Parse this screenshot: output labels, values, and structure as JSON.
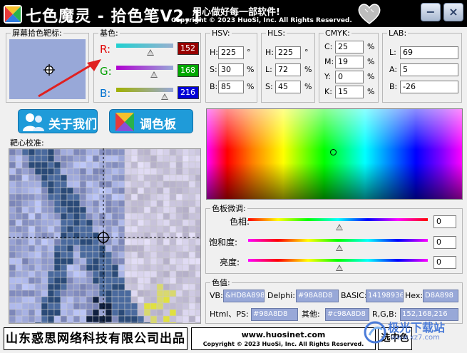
{
  "titlebar": {
    "title": "七色魔灵 - 拾色笔V2.1",
    "slogan": "用心做好每一部软件!",
    "copyright": "Copyright © 2023 HuoSi, Inc. All Rights Reserved.",
    "minimize": "−",
    "close": "×"
  },
  "target_preview": {
    "label": "屏幕拾色靶标:"
  },
  "base_color": {
    "label": "基色:",
    "channels": [
      {
        "name": "R:",
        "value": "152",
        "fraction": 0.596,
        "color": "#e00000",
        "box_color": "#980000"
      },
      {
        "name": "G:",
        "value": "168",
        "fraction": 0.659,
        "color": "#00a000",
        "box_color": "#00a800"
      },
      {
        "name": "B:",
        "value": "216",
        "fraction": 0.847,
        "color": "#0070d0",
        "box_color": "#0000d8"
      }
    ]
  },
  "hsv": {
    "label": "HSV:",
    "fields": [
      {
        "name": "H:",
        "value": "225",
        "unit": "°"
      },
      {
        "name": "S:",
        "value": "30",
        "unit": "%"
      },
      {
        "name": "B:",
        "value": "85",
        "unit": "%"
      }
    ]
  },
  "hls": {
    "label": "HLS:",
    "fields": [
      {
        "name": "H:",
        "value": "225",
        "unit": "°"
      },
      {
        "name": "L:",
        "value": "72",
        "unit": "%"
      },
      {
        "name": "S:",
        "value": "45",
        "unit": "%"
      }
    ]
  },
  "cmyk": {
    "label": "CMYK:",
    "fields": [
      {
        "name": "C:",
        "value": "25",
        "unit": "%"
      },
      {
        "name": "M:",
        "value": "19",
        "unit": "%"
      },
      {
        "name": "Y:",
        "value": "0",
        "unit": "%"
      },
      {
        "name": "K:",
        "value": "15",
        "unit": "%"
      }
    ]
  },
  "lab": {
    "label": "LAB:",
    "fields": [
      {
        "name": "L:",
        "value": "69"
      },
      {
        "name": "A:",
        "value": "5"
      },
      {
        "name": "B:",
        "value": "-26"
      }
    ]
  },
  "buttons": {
    "about": "关于我们",
    "palette": "调色板"
  },
  "calibration": {
    "label": "靶心校准:"
  },
  "fine_tune": {
    "label": "色板微调:",
    "sliders": [
      {
        "name": "色相:",
        "value": "0"
      },
      {
        "name": "饱和度:",
        "value": "0"
      },
      {
        "name": "亮度:",
        "value": "0"
      }
    ]
  },
  "color_values": {
    "label": "色值:",
    "vb_label": "VB:",
    "vb_value": "&HD8A898&",
    "delphi_label": "Delphi:",
    "delphi_value": "#98A8D8",
    "basic_label": "BASIC:",
    "basic_value": "14198936",
    "hex_label": "Hex:",
    "hex_value": "D8A898",
    "html_label": "Html、PS:",
    "html_value": "#98A8D8",
    "other_label": "其他:",
    "other_value": "#c98A8D8",
    "rgb_label": "R,G,B:",
    "rgb_value": "152,168,216"
  },
  "footer": {
    "company": "山东惑思网络科技有限公司出品",
    "url": "www.huosinet.com",
    "copyright": "Copyright © 2023 HuoSi, Inc. All Rights Reserved.",
    "pick_button": "选中色"
  },
  "watermark": {
    "text": "极光下载站",
    "url": "www.xz7.com"
  },
  "colors": {
    "picked": "#98a8d8",
    "accent_button": "#1f9bd9",
    "title_bg": "#000000"
  }
}
